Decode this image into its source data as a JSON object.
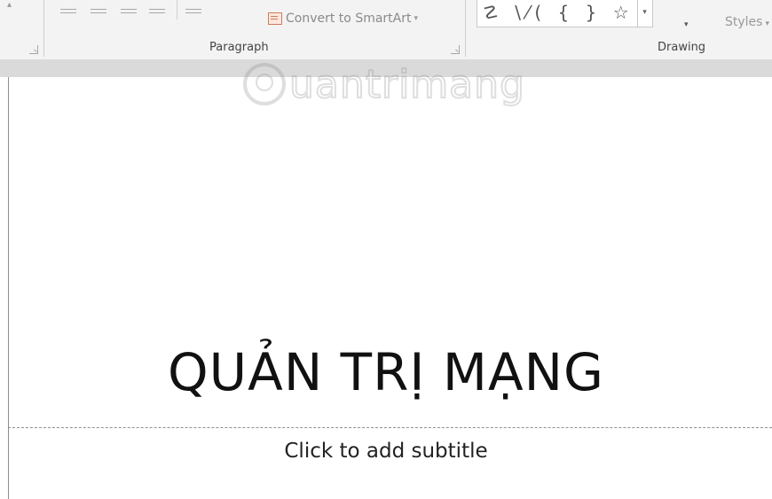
{
  "ribbon": {
    "groups": {
      "paragraph_label": "Paragraph",
      "drawing_label": "Drawing"
    },
    "convert_smartart_label": "Convert to SmartArt",
    "shapes_glyphs": "☡ \\⁄( { } ☆",
    "styles_label": "Styles",
    "dropdown_caret": "▾",
    "gallery_more": "▾"
  },
  "slide": {
    "watermark_text": "uantrimang",
    "title": "QUẢN TRỊ MẠNG",
    "subtitle_placeholder": "Click to add subtitle"
  }
}
